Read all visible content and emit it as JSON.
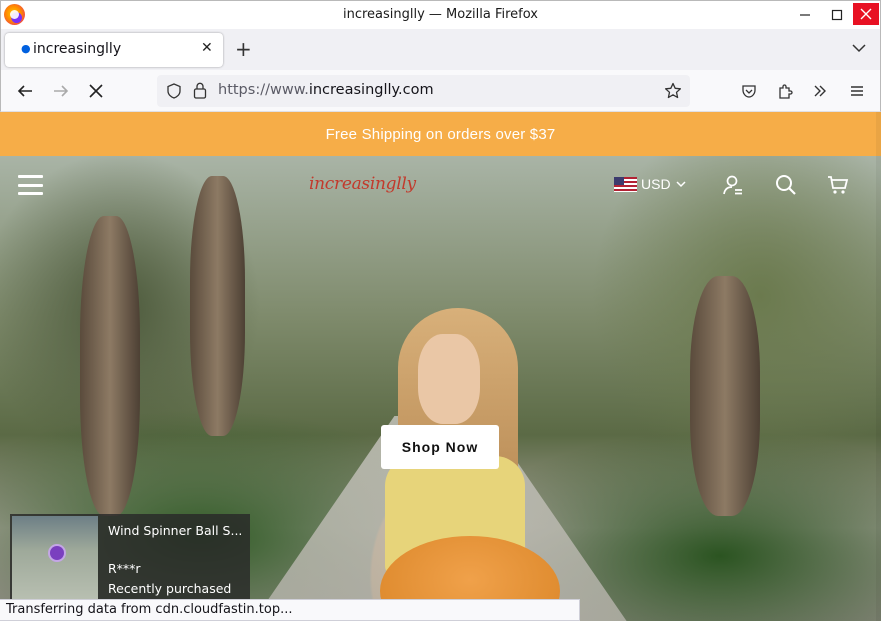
{
  "window": {
    "title": "increasinglly — Mozilla Firefox"
  },
  "tabs": [
    {
      "label": "increasinglly",
      "active": true
    }
  ],
  "navbar": {
    "url_prefix": "https://www.",
    "url_domain": "increasinglly.com"
  },
  "page": {
    "promo_text": "Free Shipping on orders over $37",
    "logo_text": "increasinglly",
    "currency": "USD",
    "cta_label": "Shop Now",
    "colors": {
      "promo_bg": "#f6ad48",
      "logo": "#c23a2c"
    }
  },
  "purchase_popup": {
    "product": "Wind Spinner Ball S...",
    "customer": "R***r",
    "status": "Recently purchased"
  },
  "status_bar": {
    "text": "Transferring data from cdn.cloudfastin.top..."
  },
  "icons": {
    "titlebar": [
      "firefox-logo-icon",
      "minimize-icon",
      "maximize-icon",
      "close-icon"
    ],
    "nav": [
      "back-icon",
      "forward-icon",
      "stop-icon",
      "shield-icon",
      "lock-icon",
      "bookmark-star-icon",
      "pocket-icon",
      "extensions-icon",
      "overflow-icon",
      "menu-icon"
    ],
    "site": [
      "hamburger-icon",
      "flag-us-icon",
      "chevron-down-icon",
      "account-icon",
      "search-icon",
      "cart-icon"
    ]
  }
}
